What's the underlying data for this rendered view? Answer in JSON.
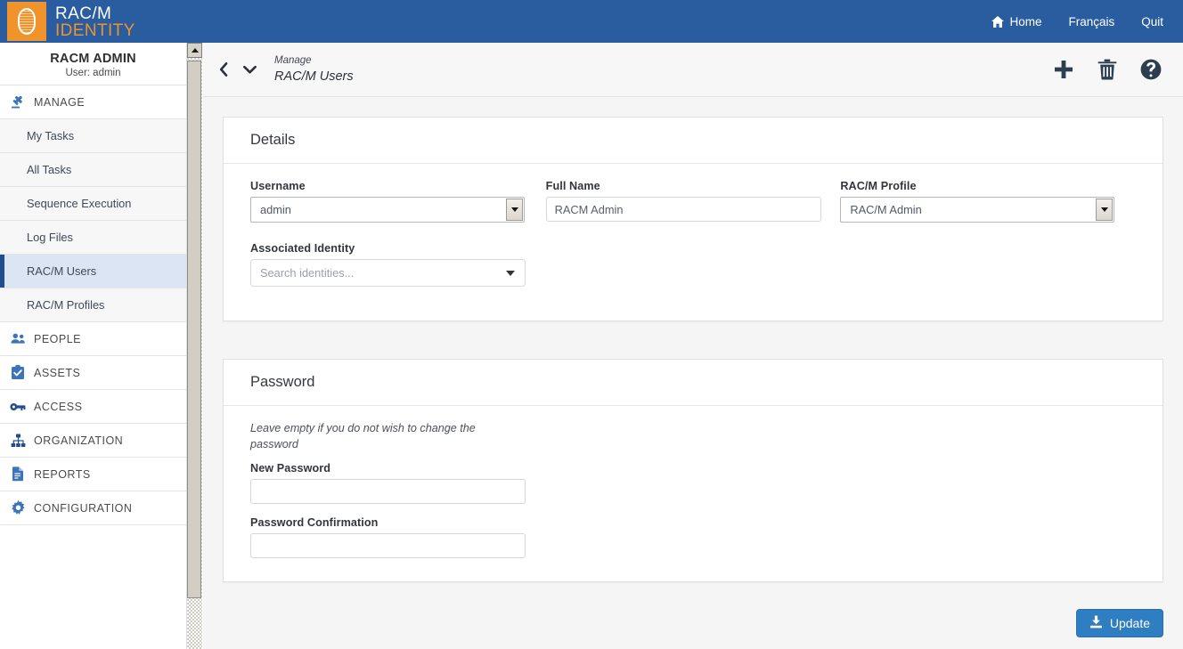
{
  "header": {
    "brand_line1": "RAC/M",
    "brand_line2": "IDENTITY",
    "logo_icon": "fingerprint-icon",
    "nav": [
      {
        "label": "Home",
        "icon": "home-icon"
      },
      {
        "label": "Français",
        "icon": ""
      },
      {
        "label": "Quit",
        "icon": ""
      }
    ]
  },
  "sidebar": {
    "user_name": "RACM ADMIN",
    "user_sub": "User: admin",
    "sections": [
      {
        "label": "MANAGE",
        "icon": "gavel-icon"
      },
      {
        "label": "PEOPLE",
        "icon": "people-icon"
      },
      {
        "label": "ASSETS",
        "icon": "clipboard-check-icon"
      },
      {
        "label": "ACCESS",
        "icon": "key-icon"
      },
      {
        "label": "ORGANIZATION",
        "icon": "sitemap-icon"
      },
      {
        "label": "REPORTS",
        "icon": "document-icon"
      },
      {
        "label": "CONFIGURATION",
        "icon": "gear-icon"
      }
    ],
    "manage_items": [
      {
        "label": "My Tasks",
        "active": false
      },
      {
        "label": "All Tasks",
        "active": false
      },
      {
        "label": "Sequence Execution",
        "active": false
      },
      {
        "label": "Log Files",
        "active": false
      },
      {
        "label": "RAC/M Users",
        "active": true
      },
      {
        "label": "RAC/M Profiles",
        "active": false
      }
    ]
  },
  "content_head": {
    "back_icon": "chevron-left-icon",
    "dropdown_icon": "chevron-down-icon",
    "breadcrumb_parent": "Manage",
    "breadcrumb_current": "RAC/M Users",
    "tools": [
      {
        "name": "add-icon",
        "title": "Add"
      },
      {
        "name": "delete-icon",
        "title": "Delete"
      },
      {
        "name": "help-icon",
        "title": "Help"
      }
    ]
  },
  "details": {
    "title": "Details",
    "username_label": "Username",
    "username_value": "admin",
    "fullname_label": "Full Name",
    "fullname_value": "RACM Admin",
    "profile_label": "RAC/M Profile",
    "profile_value": "RAC/M Admin",
    "identity_label": "Associated Identity",
    "identity_placeholder": "Search identities..."
  },
  "password": {
    "title": "Password",
    "hint": "Leave empty if you do not wish to change the password",
    "new_label": "New Password",
    "new_value": "",
    "confirm_label": "Password Confirmation",
    "confirm_value": ""
  },
  "footer": {
    "update_label": "Update",
    "update_icon": "save-download-icon"
  },
  "colors": {
    "header_blue": "#2a5ca0",
    "accent_orange": "#f0932b",
    "active_item_blue": "#dbe5f4",
    "active_bar_blue": "#1f4e8c",
    "button_blue": "#2f7ec1",
    "page_bg": "#f5f5f5"
  }
}
